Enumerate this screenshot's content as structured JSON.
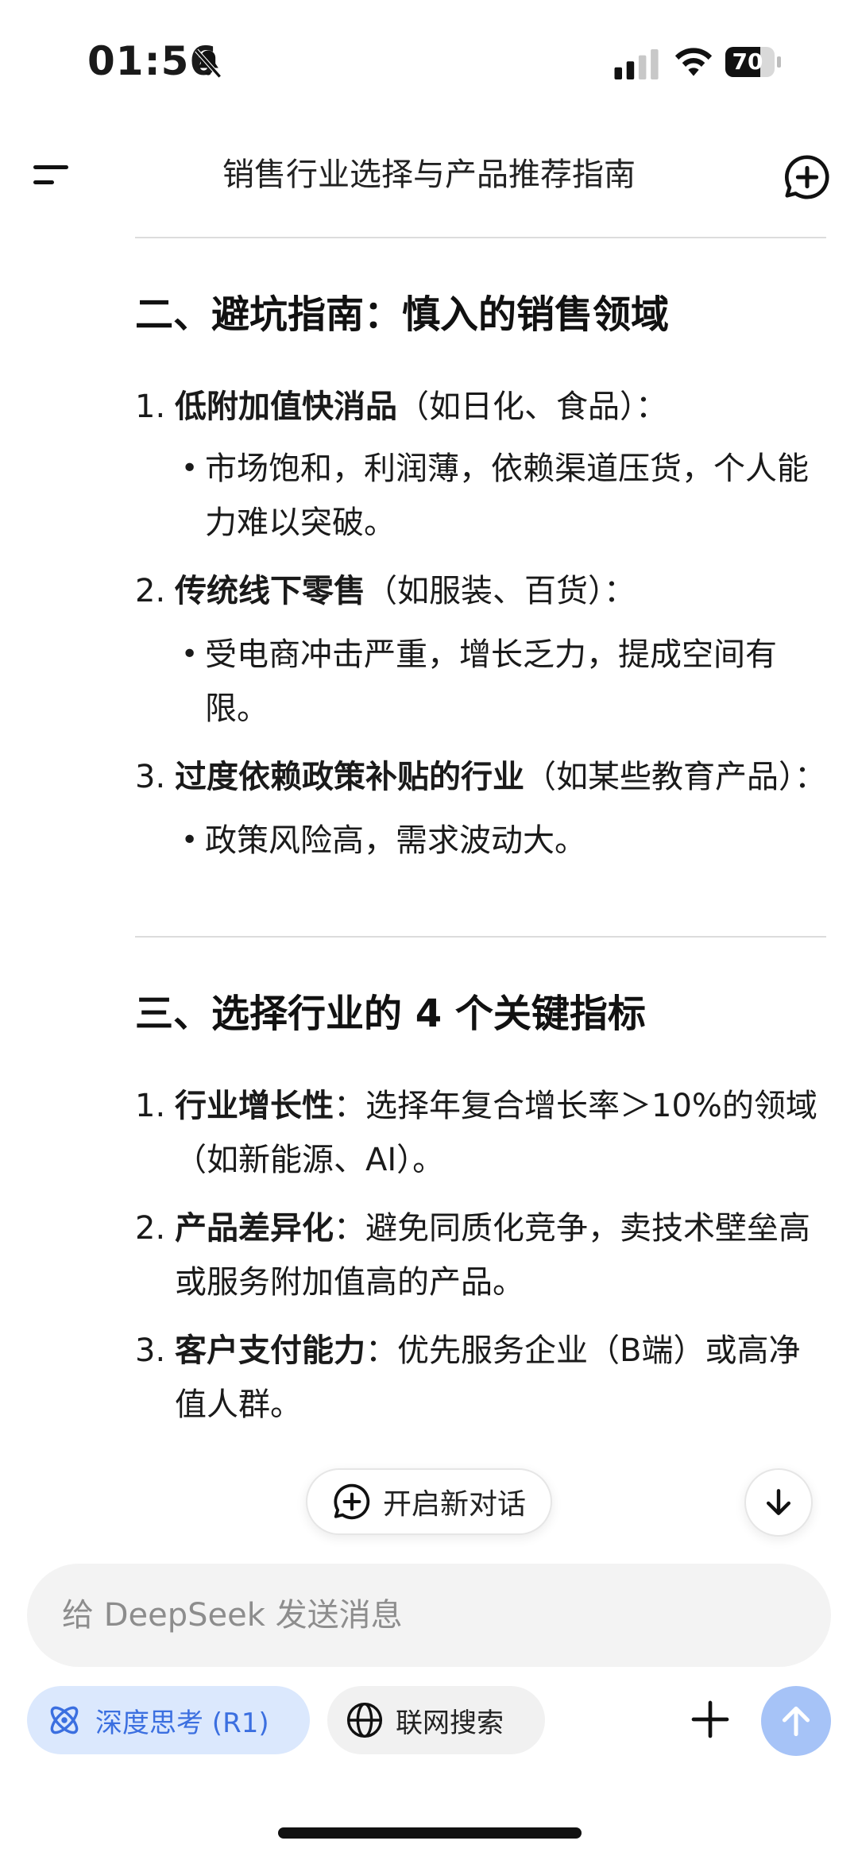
{
  "status_bar": {
    "time": "01:56",
    "battery": "70"
  },
  "header": {
    "title": "销售行业选择与产品推荐指南"
  },
  "section2": {
    "title": "二、避坑指南：慎入的销售领域",
    "items": [
      {
        "num": "1.",
        "bold": "低附加值快消品",
        "rest": "（如日化、食品）：",
        "bullets": [
          "市场饱和，利润薄，依赖渠道压货，个人能力难以突破。"
        ]
      },
      {
        "num": "2.",
        "bold": "传统线下零售",
        "rest": "（如服装、百货）：",
        "bullets": [
          "受电商冲击严重，增长乏力，提成空间有限。"
        ]
      },
      {
        "num": "3.",
        "bold": "过度依赖政策补贴的行业",
        "rest": "（如某些教育产品）：",
        "bullets": [
          "政策风险高，需求波动大。"
        ]
      }
    ]
  },
  "section3": {
    "title": "三、选择行业的 4 个关键指标",
    "items": [
      {
        "num": "1.",
        "bold": "行业增长性",
        "rest": "：选择年复合增长率＞10%的领域（如新能源、AI）。"
      },
      {
        "num": "2.",
        "bold": "产品差异化",
        "rest": "：避免同质化竞争，卖技术壁垒高或服务附加值高的产品。"
      },
      {
        "num": "3.",
        "bold": "客户支付能力",
        "rest": "：优先服务企业（B端）或高净值人群。"
      }
    ]
  },
  "floating": {
    "new_chat_label": "开启新对话"
  },
  "composer": {
    "placeholder": "给 DeepSeek 发送消息",
    "deep_think_label": "深度思考 (R1)",
    "web_search_label": "联网搜索"
  },
  "colors": {
    "accent": "#3b6fe0",
    "accent_bg": "#dbe8fd",
    "send_disabled": "#a6c3f7"
  }
}
